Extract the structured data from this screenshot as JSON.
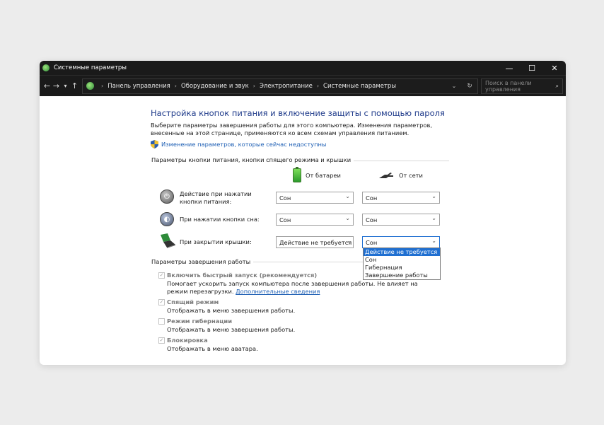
{
  "window": {
    "title": "Системные параметры",
    "controls": {
      "minimize": "—",
      "maximize": "☐",
      "close": "✕"
    }
  },
  "addressbar": {
    "breadcrumbs": [
      "Панель управления",
      "Оборудование и звук",
      "Электропитание",
      "Системные параметры"
    ],
    "search_placeholder": "Поиск в панели управления"
  },
  "main": {
    "heading": "Настройка кнопок питания и включение защиты с помощью пароля",
    "description": "Выберите параметры завершения работы для этого компьютера. Изменения параметров, внесенные на этой странице, применяются ко всем схемам управления питанием.",
    "admin_link": "Изменение параметров, которые сейчас недоступны",
    "buttons_group_label": "Параметры кнопки питания, кнопки спящего режима и крышки",
    "col_battery": "От батареи",
    "col_ac": "От сети",
    "rows": [
      {
        "label": "Действие при нажатии кнопки питания:",
        "battery": "Сон",
        "ac": "Сон"
      },
      {
        "label": "При нажатии кнопки сна:",
        "battery": "Сон",
        "ac": "Сон"
      },
      {
        "label": "При закрытии крышки:",
        "battery": "Действие не требуется",
        "ac": "Сон"
      }
    ],
    "dropdown_options": [
      "Действие не требуется",
      "Сон",
      "Гибернация",
      "Завершение работы"
    ],
    "shutdown_group_label": "Параметры завершения работы",
    "shutdown_settings": [
      {
        "label": "Включить быстрый запуск (рекомендуется)",
        "checked": true,
        "desc": "Помогает ускорить запуск компьютера после завершения работы. Не влияет на режим перезагрузки.",
        "link": "Дополнительные сведения"
      },
      {
        "label": "Спящий режим",
        "checked": true,
        "desc": "Отображать в меню завершения работы."
      },
      {
        "label": "Режим гибернации",
        "checked": false,
        "desc": "Отображать в меню завершения работы."
      },
      {
        "label": "Блокировка",
        "checked": true,
        "desc": "Отображать в меню аватара."
      }
    ]
  },
  "colors": {
    "heading": "#1e3a8a",
    "link": "#1e5fb4",
    "selection": "#1f6fd1",
    "titlebar": "#1a1a1a"
  }
}
